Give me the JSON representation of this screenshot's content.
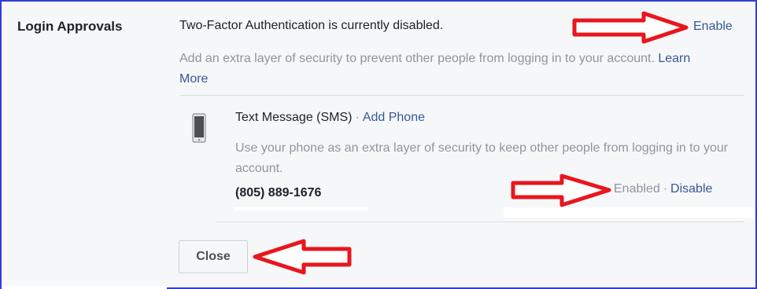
{
  "login_approvals": {
    "section_label": "Login Approvals",
    "status_text": "Two-Factor Authentication is currently disabled.",
    "enable_label": "Enable",
    "description": "Add an extra layer of security to prevent other people from logging in to your account.",
    "learn_more_label": "Learn More"
  },
  "sms_method": {
    "icon": "phone-icon",
    "title": "Text Message (SMS)",
    "separator": "·",
    "add_phone_label": "Add Phone",
    "description": "Use your phone as an extra layer of security to keep other people from logging in to your account.",
    "phone_number": "(805) 889-1676",
    "status_label": "Enabled",
    "disable_label": "Disable"
  },
  "close_label": "Close",
  "colors": {
    "link": "#365899",
    "muted_text": "#90949c",
    "annotation_arrow": "#e8161d",
    "border": "#2f3fd6"
  }
}
